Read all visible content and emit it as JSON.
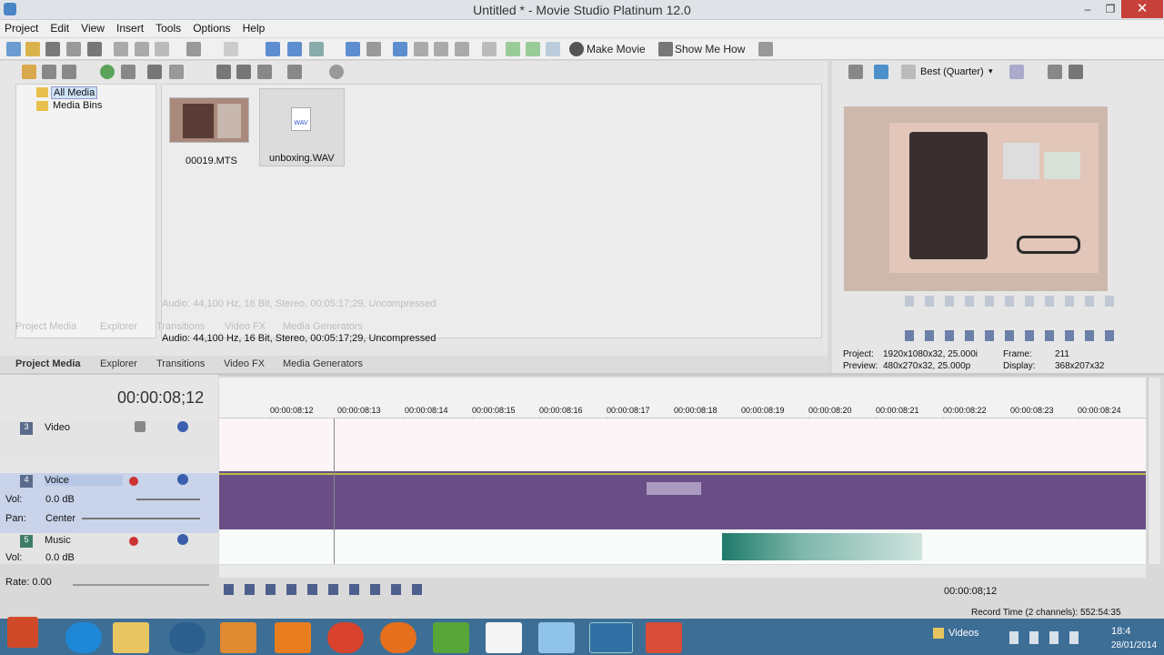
{
  "window": {
    "title": "Untitled * - Movie Studio Platinum 12.0",
    "min": "–",
    "max": "❐",
    "close": "✕"
  },
  "menu": [
    "Project",
    "Edit",
    "View",
    "Insert",
    "Tools",
    "Options",
    "Help"
  ],
  "toolbar": {
    "make_movie": "Make Movie",
    "show_me_how": "Show Me How"
  },
  "media": {
    "tree": [
      "All Media",
      "Media Bins"
    ],
    "files": [
      "00019.MTS",
      "unboxing.WAV"
    ],
    "status": "Audio: 44,100 Hz, 16 Bit, Stereo, 00:05:17;29, Uncompressed",
    "tabs": [
      "Project Media",
      "Explorer",
      "Transitions",
      "Video FX",
      "Media Generators"
    ]
  },
  "preview": {
    "quality": "Best (Quarter)",
    "project_label": "Project:",
    "project_value": "1920x1080x32, 25.000i",
    "preview_label": "Preview:",
    "preview_value": "480x270x32, 25.000p",
    "frame_label": "Frame:",
    "frame_value": "211",
    "display_label": "Display:",
    "display_value": "368x207x32",
    "wav_label": "WAV"
  },
  "timeline": {
    "timecode": "00:00:08;12",
    "ticks": [
      "00:00:08:12",
      "00:00:08:13",
      "00:00:08:14",
      "00:00:08:15",
      "00:00:08:16",
      "00:00:08:17",
      "00:00:08:18",
      "00:00:08:19",
      "00:00:08:20",
      "00:00:08:21",
      "00:00:08:22",
      "00:00:08:23",
      "00:00:08:24"
    ],
    "tracks": [
      {
        "num": "3",
        "name": "Video"
      },
      {
        "num": "4",
        "name": "Voice",
        "vol_label": "Vol:",
        "vol": "0.0 dB",
        "pan_label": "Pan:",
        "pan": "Center"
      },
      {
        "num": "5",
        "name": "Music",
        "vol_label": "Vol:",
        "vol": "0.0 dB"
      }
    ],
    "rate": "Rate: 0.00",
    "cursor_time": "00:00:08;12",
    "record_time": "Record Time (2 channels): 552:54:35"
  },
  "taskbar": {
    "videos_label": "Videos",
    "clock": "18:4",
    "date": "28/01/2014"
  },
  "colors": {
    "taskbar": "#3d6e96",
    "voice_track": "#6a4f86",
    "selection": "#cde3f7"
  }
}
